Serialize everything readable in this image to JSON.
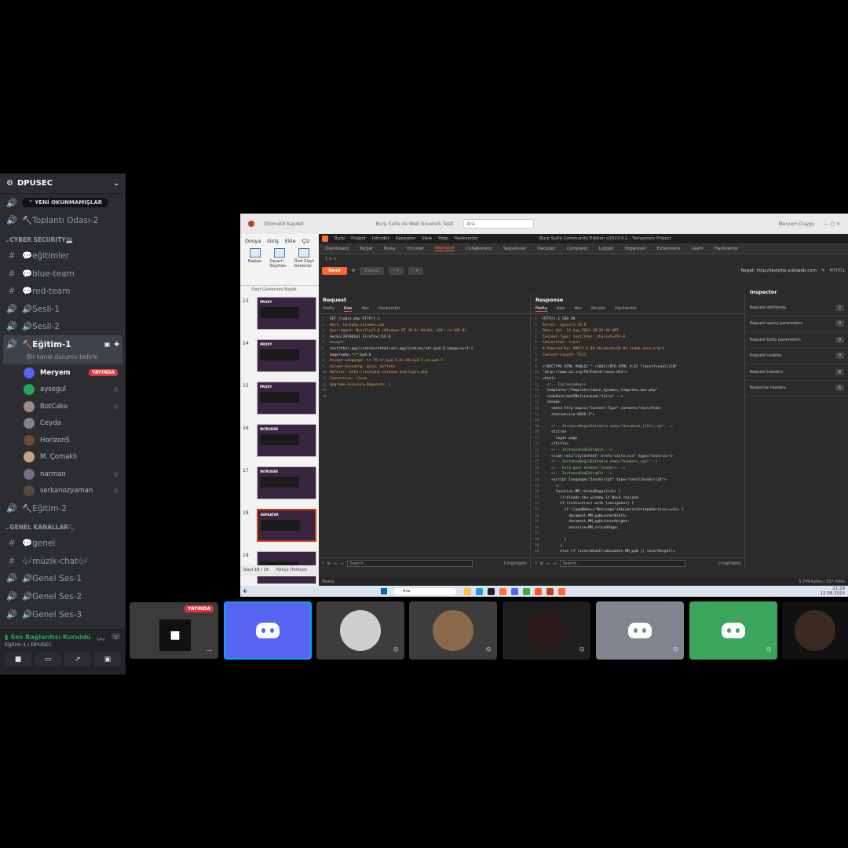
{
  "server": {
    "name": "DPUSEC"
  },
  "new_unread": "YENİ OKUNMAMIŞLAR",
  "channels_top": [
    {
      "icon": "speaker-icon",
      "label": "🔨Toplantı Odası-2",
      "type": "voice"
    }
  ],
  "category_cyber": "CYBER SECURITY💻",
  "category_cyber_icon": "💻",
  "channels_cyber": [
    {
      "label": "💬eğitimler",
      "type": "text"
    },
    {
      "label": "💬blue-team",
      "type": "text"
    },
    {
      "label": "💬red-team",
      "type": "text"
    },
    {
      "label": "🔊Sesli-1",
      "type": "voice"
    },
    {
      "label": "🔊Sesli-2",
      "type": "voice"
    }
  ],
  "active_channel": {
    "label": "🔨Eğitim-1",
    "status_hint": "Bir kanal durumu belirle"
  },
  "voice_users": [
    {
      "name": "Meryem",
      "live": "YAYINDA",
      "color": "#5865f2"
    },
    {
      "name": "aysegul",
      "color": "#23a55a"
    },
    {
      "name": "BotCake",
      "color": "#9c8a8a"
    },
    {
      "name": "Ceyda",
      "color": "#80848e"
    },
    {
      "name": "HorizonS",
      "color": "#6b4a3a"
    },
    {
      "name": "M. Çomaklı",
      "color": "#c4a58a"
    },
    {
      "name": "narman",
      "color": "#7a6a8a"
    },
    {
      "name": "serkanozyaman",
      "color": "#5a4a3a"
    }
  ],
  "channel_egitim2": "🔨Eğitim-2",
  "category_general": "GENEL KANALLAR📞",
  "channels_general": [
    {
      "label": "💬genel",
      "type": "text"
    },
    {
      "label": "🎶müzik-chat🎶",
      "type": "text"
    },
    {
      "label": "🔊Genel Ses-1",
      "type": "voice"
    },
    {
      "label": "🔊Genel Ses-2",
      "type": "voice"
    },
    {
      "label": "🔊Genel Ses-3",
      "type": "voice"
    }
  ],
  "voice_panel": {
    "status": "Ses Bağlantısı Kuruldu",
    "location": "Eğitim-1 / DPUSEC"
  },
  "ppt": {
    "title": "Otomatik Kaydet",
    "doc": "Burp Suite ile Web Güvenlik Testi",
    "search": "Ara",
    "user": "Meryem Duygu",
    "menu": [
      "Dosya",
      "Giriş",
      "Ekle",
      "Çiz"
    ],
    "ribbon": [
      "Baştan",
      "Geçerli Slayttan",
      "Özel Slayt Gösterisi"
    ],
    "ribbon_group": "Slayt Gösterisini Başlat",
    "slides": [
      {
        "num": "13",
        "title": "PROXY"
      },
      {
        "num": "14",
        "title": "PROXY"
      },
      {
        "num": "15",
        "title": "PROXY"
      },
      {
        "num": "16",
        "title": "INTRUDER"
      },
      {
        "num": "17",
        "title": "INTRUDER"
      },
      {
        "num": "18",
        "title": "REPEATER"
      },
      {
        "num": "19",
        "title": ""
      }
    ],
    "status": "Slayt 18 / 19",
    "lang": "Türkçe (Türkiye)"
  },
  "burp": {
    "menu": [
      "Burp",
      "Project",
      "Intruder",
      "Repeater",
      "View",
      "Help",
      "Hackvertor"
    ],
    "title": "Burp Suite Community Edition v2023.9.1 - Temporary Project",
    "tabs": [
      "Dashboard",
      "Target",
      "Proxy",
      "Intruder",
      "Repeater",
      "Collaborator",
      "Sequencer",
      "Decoder",
      "Comparer",
      "Logger",
      "Organizer",
      "Extensions",
      "Learn",
      "Hackvertor"
    ],
    "active_tab": "Repeater",
    "subtab": "1 ×   +",
    "send": "Send",
    "cancel": "Cancel",
    "target": "Target: http://testphp.vulnweb.com",
    "http": "HTTP/1",
    "request_title": "Request",
    "response_title": "Response",
    "req_tabs": [
      "Pretty",
      "Raw",
      "Hex",
      "Hackvertor"
    ],
    "res_tabs": [
      "Pretty",
      "Raw",
      "Hex",
      "Render",
      "Hackvertor"
    ],
    "request_lines": [
      "GET /login.php HTTP/1.1",
      "Host: testphp.vulnweb.com",
      "User-Agent: Mozilla/5.0 (Windows NT 10.0; Win64; x64; rv:109.0)",
      "Gecko/20100101 Firefox/116.0",
      "Accept:",
      "text/html,application/xhtml+xml,application/xml;q=0.9,image/avif,i",
      "mage/webp,*/*;q=0.8",
      "Accept-Language: tr-TR,tr;q=0.8,en-US;q=0.5,en;q=0.3",
      "Accept-Encoding: gzip, deflate",
      "Referer: http://testphp.vulnweb.com/login.php",
      "Connection: close",
      "Upgrade-Insecure-Requests: 1",
      "",
      ""
    ],
    "response_lines": [
      "HTTP/1.1 200 OK",
      "Server: nginx/1.19.0",
      "Date: Sat, 12 Aug 2023 18:29:39 GMT",
      "Content-Type: text/html; charset=UTF-8",
      "Connection: close",
      "X-Powered-By: PHP/5.6.40-38+ubuntu20.04.1+deb.sury.org+1",
      "Content-Length: 5523",
      "",
      "<!DOCTYPE HTML PUBLIC \"-//W3C//DTD HTML 4.01 Transitional//EN\"",
      "\"http://www.w3.org/TR/html4/loose.dtd\">",
      "<html>",
      "  <!-- InstanceBegin",
      "  template=\"/Templates/main_dynamic_template.dwt.php\"",
      "  codeOutsideHTMLIsLocked=\"false\" -->",
      "  <head>",
      "    <meta http-equiv=\"Content-Type\" content=\"text/html;",
      "    charset=iso-8859-1\">",
      "",
      "    <!-- InstanceBeginEditable name=\"document_title_rgn\" -->",
      "    <title>",
      "      login page",
      "    </title>",
      "    <!-- InstanceEndEditable -->",
      "    <link rel=\"stylesheet\" href=\"style.css\" type=\"text/css\">",
      "    <!-- InstanceBeginEditable name=\"headers_rgn\" -->",
      "    <!-- here goes headers headers -->",
      "    <!-- InstanceEndEditable -->",
      "    <script language=\"JavaScript\" type=\"text/JavaScript\">",
      "      <!--",
      "      function MM_reloadPage(init) {",
      "        //reloads the window if Nav4 resized",
      "        if (init==true) with (navigator) {",
      "          if ((appName==\"Netscape\")&&(parseInt(appVersion)==4)) {",
      "            document.MM_pgW=innerWidth;",
      "            document.MM_pgH=innerHeight;",
      "            onresize=MM_reloadPage;",
      "",
      "          }",
      "        }",
      "        else if (innerWidth!=document.MM_pgW || innerHeight!="
    ],
    "search_ph": "Search...",
    "highlights": "0 highlights",
    "inspector_title": "Inspector",
    "inspector_rows": [
      {
        "label": "Request attributes",
        "count": "2"
      },
      {
        "label": "Request query parameters",
        "count": "0"
      },
      {
        "label": "Request body parameters",
        "count": "0"
      },
      {
        "label": "Request cookies",
        "count": "0"
      },
      {
        "label": "Request headers",
        "count": "8"
      },
      {
        "label": "Response headers",
        "count": "6"
      }
    ],
    "status": "Ready",
    "size": "5,749 bytes | 157 millis"
  },
  "taskbar": {
    "search": "Ara",
    "time": "21:29",
    "date": "12.08.2023"
  },
  "stream_live": "YAYINDA",
  "tiles": [
    {
      "color": "#5865f2"
    },
    {
      "color": "#3d3d3d"
    },
    {
      "color": "#3d3d3d"
    },
    {
      "color": "#1e1e1e"
    },
    {
      "color": "#80848e"
    },
    {
      "color": "#3ba55c"
    },
    {
      "color": "#111111"
    }
  ]
}
